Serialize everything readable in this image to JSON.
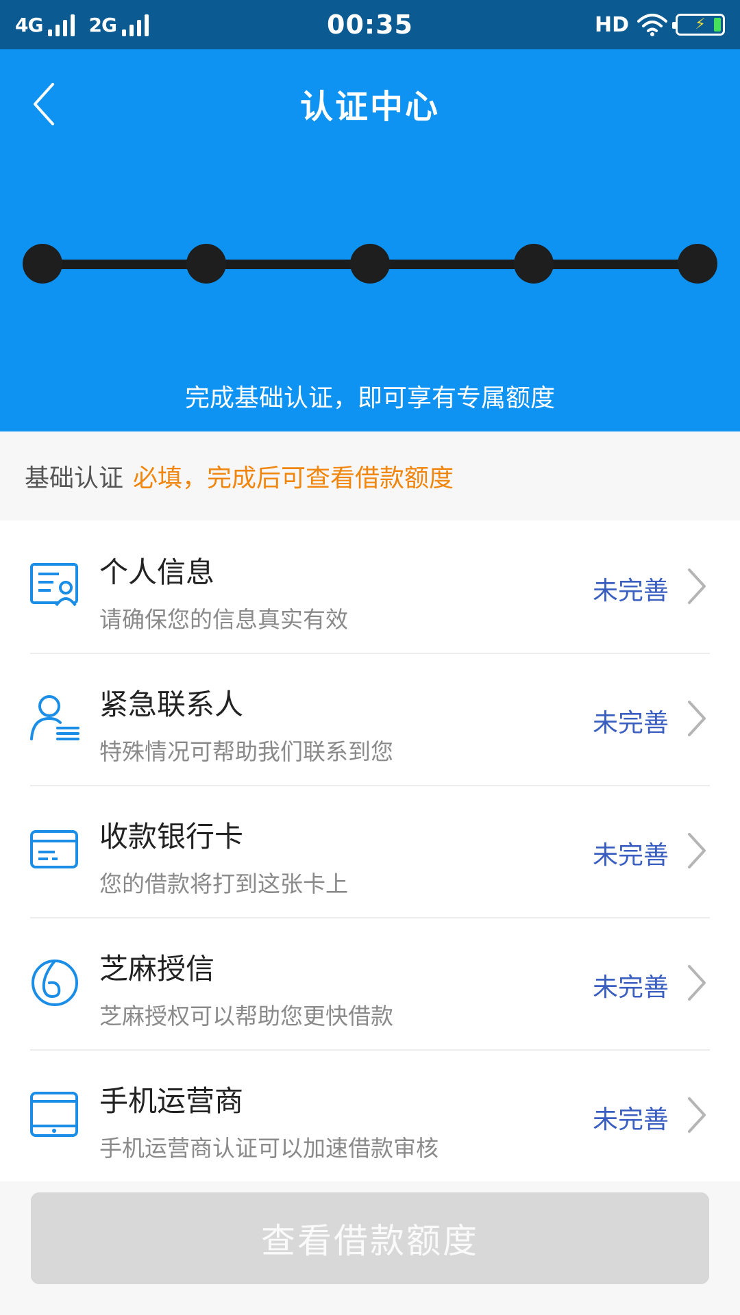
{
  "status_bar": {
    "network1": "4G",
    "network2": "2G",
    "time": "00:35",
    "hd": "HD"
  },
  "header": {
    "title": "认证中心",
    "caption": "完成基础认证，即可享有专属额度",
    "step_count": 5
  },
  "section": {
    "title": "基础认证",
    "note": "必填，完成后可查看借款额度"
  },
  "items": [
    {
      "title": "个人信息",
      "subtitle": "请确保您的信息真实有效",
      "status": "未完善",
      "icon": "id-card-icon"
    },
    {
      "title": "紧急联系人",
      "subtitle": "特殊情况可帮助我们联系到您",
      "status": "未完善",
      "icon": "contact-person-icon"
    },
    {
      "title": "收款银行卡",
      "subtitle": "您的借款将打到这张卡上",
      "status": "未完善",
      "icon": "bank-card-icon"
    },
    {
      "title": "芝麻授信",
      "subtitle": "芝麻授权可以帮助您更快借款",
      "status": "未完善",
      "icon": "sesame-credit-icon"
    },
    {
      "title": "手机运营商",
      "subtitle": "手机运营商认证可以加速借款审核",
      "status": "未完善",
      "icon": "tablet-icon"
    }
  ],
  "footer": {
    "button_label": "查看借款额度"
  },
  "colors": {
    "status_bar": "#0b5a92",
    "header": "#0e93f2",
    "accent_icon": "#1a8de6",
    "note": "#f0860e",
    "status_text": "#3a5fc0",
    "button_disabled": "#d8d8d8"
  }
}
